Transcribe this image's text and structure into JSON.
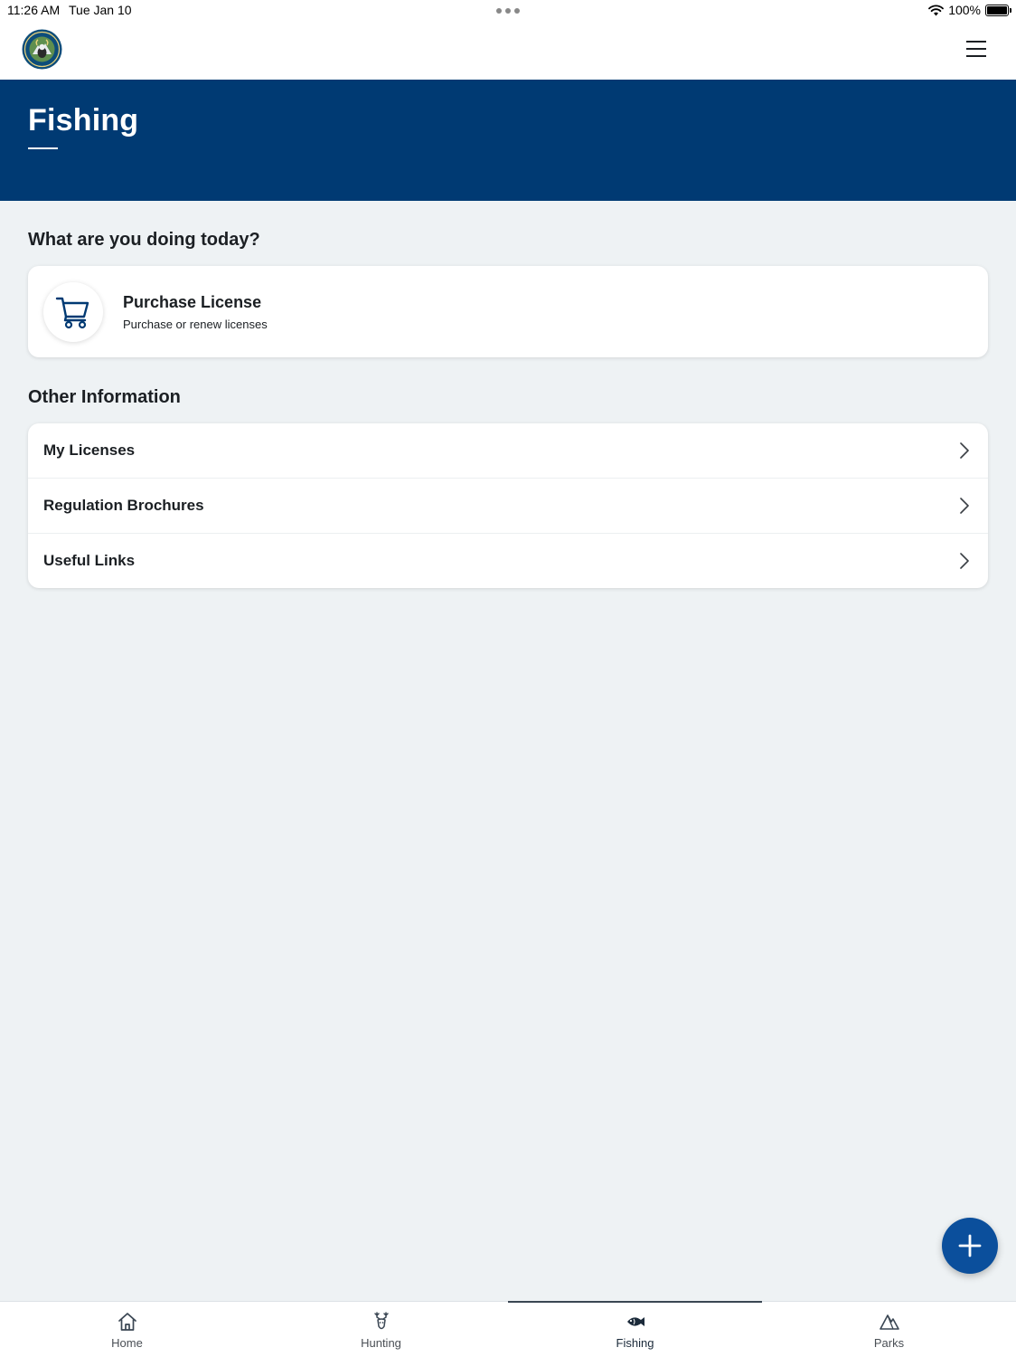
{
  "status_bar": {
    "time": "11:26 AM",
    "date": "Tue Jan 10",
    "battery": "100%"
  },
  "header": {
    "logo": "colorado-parks-wildlife-logo",
    "menu_icon": "hamburger-menu-icon"
  },
  "hero": {
    "title": "Fishing"
  },
  "actions": {
    "section_title": "What are you doing today?",
    "purchase": {
      "title": "Purchase License",
      "subtitle": "Purchase or renew licenses",
      "icon": "cart-icon"
    }
  },
  "other_info": {
    "section_title": "Other Information",
    "items": [
      {
        "label": "My Licenses"
      },
      {
        "label": "Regulation Brochures"
      },
      {
        "label": "Useful Links"
      }
    ]
  },
  "fab": {
    "icon": "plus-icon"
  },
  "tabs": [
    {
      "label": "Home",
      "icon": "home-icon"
    },
    {
      "label": "Hunting",
      "icon": "deer-icon"
    },
    {
      "label": "Fishing",
      "icon": "fish-icon",
      "active": true
    },
    {
      "label": "Parks",
      "icon": "mountain-icon"
    }
  ],
  "colors": {
    "primary": "#003a73",
    "fab": "#0b4f9c",
    "background": "#eef2f4"
  }
}
